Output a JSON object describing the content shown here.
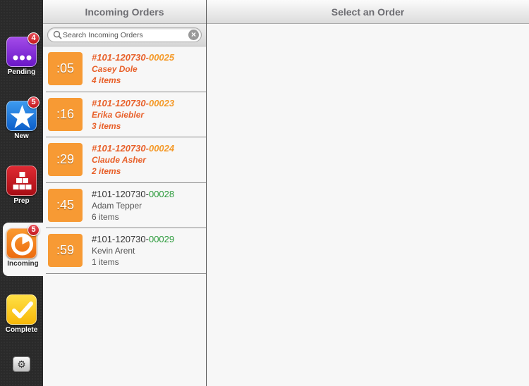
{
  "sidebar": {
    "tabs": [
      {
        "label": "Pending",
        "badge": "4",
        "icon": "dots-icon"
      },
      {
        "label": "New",
        "badge": "5",
        "icon": "star-icon"
      },
      {
        "label": "Prep",
        "badge": null,
        "icon": "blocks-icon"
      },
      {
        "label": "Incoming",
        "badge": "5",
        "icon": "timer-icon"
      },
      {
        "label": "Complete",
        "badge": null,
        "icon": "checkmark-icon"
      }
    ],
    "active_tab": "Incoming",
    "settings_icon": "gear-icon"
  },
  "master": {
    "title": "Incoming Orders",
    "search": {
      "placeholder": "Search Incoming Orders",
      "value": ""
    },
    "orders": [
      {
        "timer": ":05",
        "id_prefix": "#101-120730-",
        "id_suffix": "00025",
        "name": "Casey Dole",
        "items": "4 items",
        "urgent": true
      },
      {
        "timer": ":16",
        "id_prefix": "#101-120730-",
        "id_suffix": "00023",
        "name": "Erika Giebler",
        "items": "3 items",
        "urgent": true
      },
      {
        "timer": ":29",
        "id_prefix": "#101-120730-",
        "id_suffix": "00024",
        "name": "Claude Asher",
        "items": "2 items",
        "urgent": true
      },
      {
        "timer": ":45",
        "id_prefix": "#101-120730-",
        "id_suffix": "00028",
        "name": "Adam Tepper",
        "items": "6 items",
        "urgent": false
      },
      {
        "timer": ":59",
        "id_prefix": "#101-120730-",
        "id_suffix": "00029",
        "name": "Kevin Arent",
        "items": "1 items",
        "urgent": false
      }
    ]
  },
  "detail": {
    "title": "Select an Order"
  },
  "colors": {
    "urgent_text": "#e8602a",
    "urgent_suffix": "#f49a2a",
    "normal_suffix": "#2a9a3a",
    "timer_bg": "#f79a34"
  }
}
